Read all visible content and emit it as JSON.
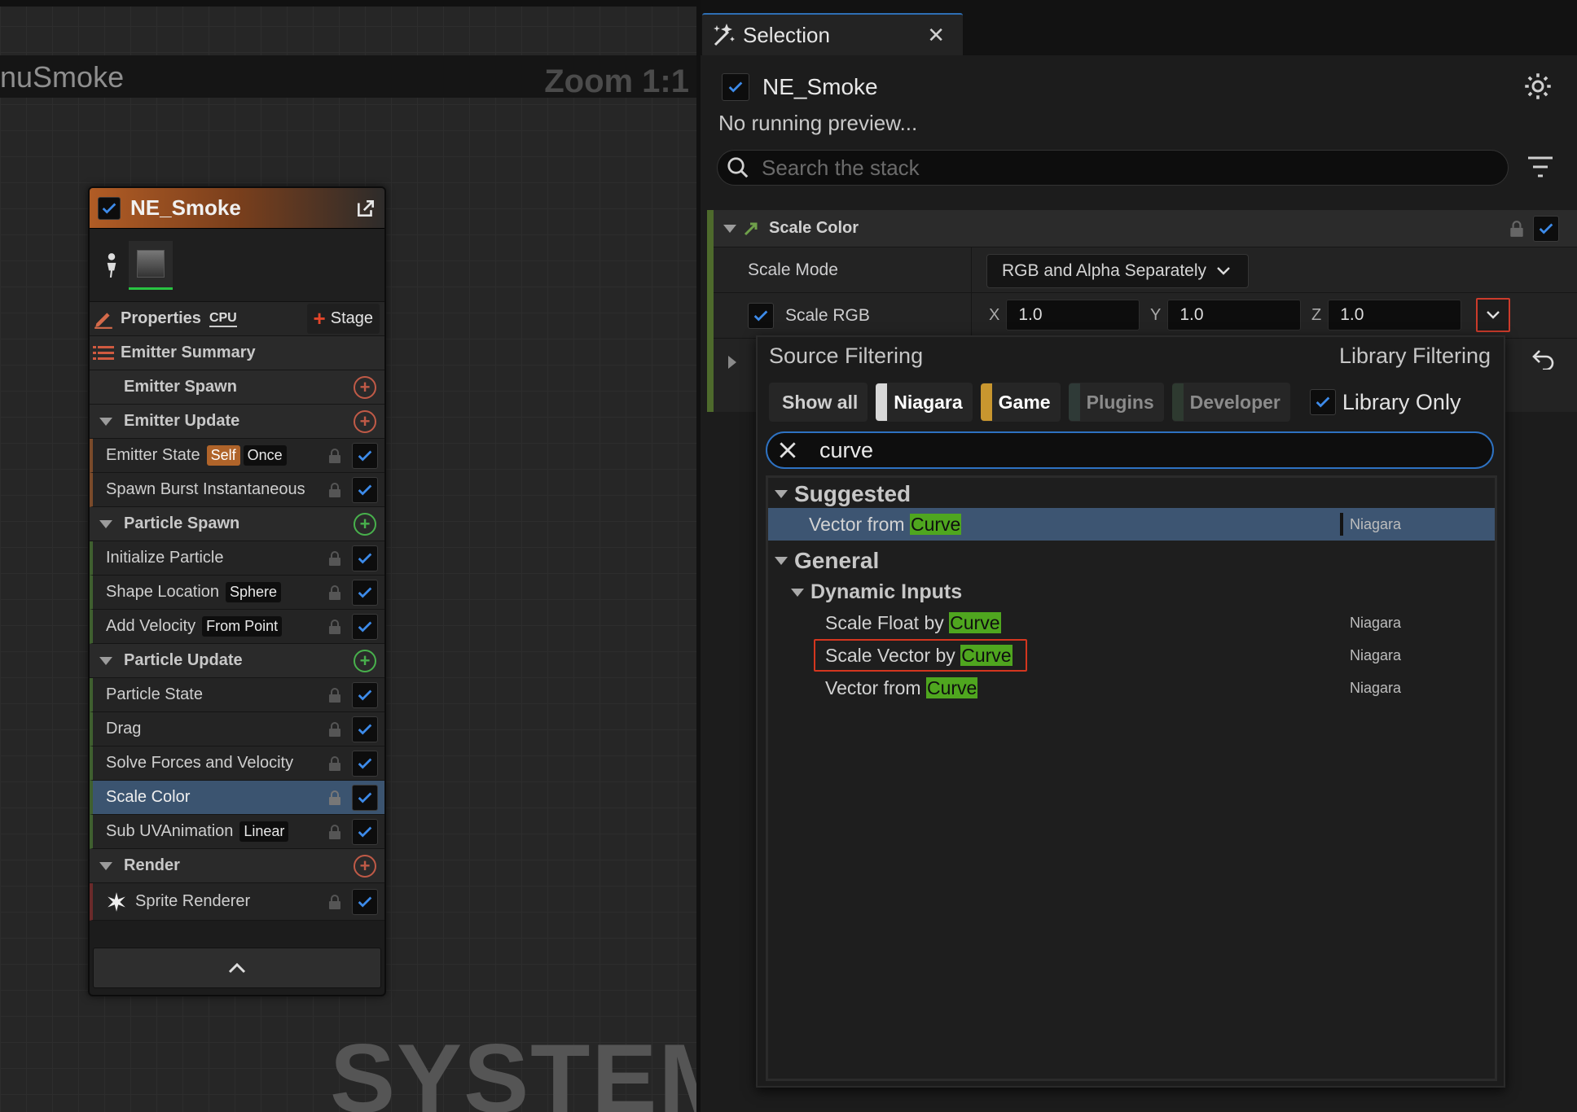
{
  "graph": {
    "title": "nuSmoke",
    "zoom": "Zoom 1:1",
    "watermark": "SYSTEM"
  },
  "node": {
    "title": "NE_Smoke",
    "properties_label": "Properties",
    "cpu_label": "CPU",
    "stage_label": "Stage",
    "sections": {
      "emitter_summary": "Emitter Summary",
      "emitter_spawn": "Emitter Spawn",
      "emitter_update": "Emitter Update",
      "particle_spawn": "Particle Spawn",
      "particle_update": "Particle Update",
      "render": "Render"
    },
    "modules": {
      "emitter_state": {
        "label": "Emitter State",
        "tag1": "Self",
        "tag2": "Once"
      },
      "spawn_burst": {
        "label": "Spawn Burst Instantaneous"
      },
      "initialize_particle": {
        "label": "Initialize Particle"
      },
      "shape_location": {
        "label": "Shape Location",
        "tag": "Sphere"
      },
      "add_velocity": {
        "label": "Add Velocity",
        "tag": "From Point"
      },
      "particle_state": {
        "label": "Particle State"
      },
      "drag": {
        "label": "Drag"
      },
      "solve_forces": {
        "label": "Solve Forces and Velocity"
      },
      "scale_color": {
        "label": "Scale Color"
      },
      "sub_uv": {
        "label": "Sub UVAnimation",
        "tag": "Linear"
      },
      "sprite_renderer": {
        "label": "Sprite Renderer"
      }
    }
  },
  "panel": {
    "tab_label": "Selection",
    "emitter_name": "NE_Smoke",
    "preview_status": "No running preview...",
    "search_placeholder": "Search the stack",
    "module": {
      "title": "Scale Color",
      "scale_mode_label": "Scale Mode",
      "scale_mode_value": "RGB and Alpha Separately",
      "scale_rgb_label": "Scale RGB",
      "x_label": "X",
      "x_value": "1.0",
      "y_label": "Y",
      "y_value": "1.0",
      "z_label": "Z",
      "z_value": "1.0"
    }
  },
  "popup": {
    "source_filtering": "Source Filtering",
    "library_filtering": "Library Filtering",
    "chips": {
      "show_all": "Show all",
      "niagara": "Niagara",
      "game": "Game",
      "plugins": "Plugins",
      "developer": "Developer"
    },
    "library_only": "Library Only",
    "search_value": "curve",
    "categories": {
      "suggested": "Suggested",
      "general": "General",
      "dynamic_inputs": "Dynamic Inputs"
    },
    "items": {
      "sug_vector": {
        "prefix": "Vector from ",
        "match": "Curve",
        "source": "Niagara"
      },
      "scale_float": {
        "prefix": "Scale Float by ",
        "match": "Curve",
        "source": "Niagara"
      },
      "scale_vector": {
        "prefix": "Scale Vector by ",
        "match": "Curve",
        "source": "Niagara"
      },
      "vector_from": {
        "prefix": "Vector from ",
        "match": "Curve",
        "source": "Niagara"
      }
    }
  },
  "colors": {
    "accent_blue": "#2e72c2",
    "match_highlight": "#4fa61f",
    "selection_row": "#3b5470",
    "highlight_box": "#d4361f",
    "niagara_chip": "#d8d8d8",
    "game_chip": "#c8962f"
  }
}
